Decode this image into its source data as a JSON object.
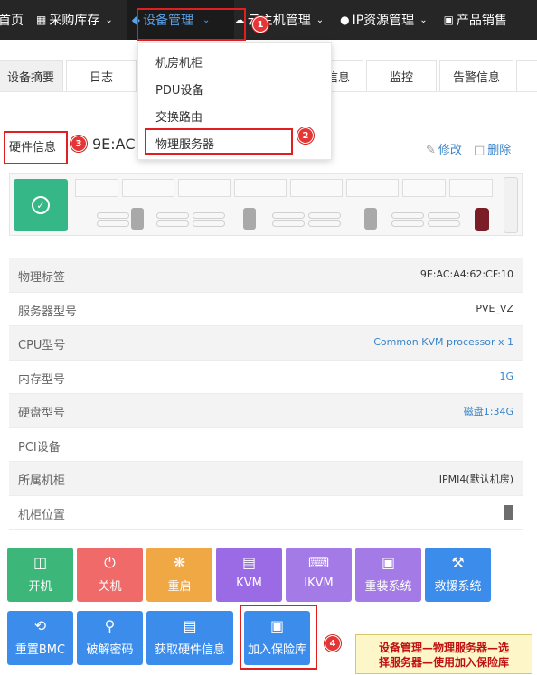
{
  "nav": {
    "home": "首页",
    "purchase": "采购库存",
    "device_mgmt": "设备管理",
    "cloud": "云主机管理",
    "ip": "IP资源管理",
    "product": "产品销售"
  },
  "tabs": [
    "设备摘要",
    "日志",
    "信息",
    "监控",
    "告警信息"
  ],
  "dropdown": [
    "机房机柜",
    "PDU设备",
    "交换路由",
    "物理服务器"
  ],
  "hardware": {
    "section_label": "硬件信息",
    "title": "9E:AC:A",
    "edit": "修改",
    "delete": "删除"
  },
  "info": [
    {
      "label": "物理标签",
      "value": "9E:AC:A4:62:CF:10"
    },
    {
      "label": "服务器型号",
      "value": "PVE_VZ"
    },
    {
      "label": "CPU型号",
      "value": "Common KVM processor x 1"
    },
    {
      "label": "内存型号",
      "value": "1G"
    },
    {
      "label": "硬盘型号",
      "value": "磁盘1:34G"
    },
    {
      "label": "PCI设备",
      "value": ""
    },
    {
      "label": "所属机柜",
      "value": "IPMI4(默认机房)"
    },
    {
      "label": "机柜位置",
      "value": ""
    }
  ],
  "buttons": {
    "power_on": "开机",
    "power_off": "关机",
    "restart": "重启",
    "kvm": "KVM",
    "ikvm": "IKVM",
    "reinstall": "重装系统",
    "rescue": "救援系统",
    "reset_bmc": "重置BMC",
    "crack_password": "破解密码",
    "get_hardware": "获取硬件信息",
    "add_insurance": "加入保险库"
  },
  "badges": [
    "1",
    "2",
    "3",
    "4"
  ],
  "note": {
    "line1": "设备管理—物理服务器—选",
    "line2": "择服务器—使用加入保险库"
  },
  "colors": {
    "nav_bg": "#262626",
    "accent": "#3a84c9",
    "highlight": "#e02020"
  }
}
